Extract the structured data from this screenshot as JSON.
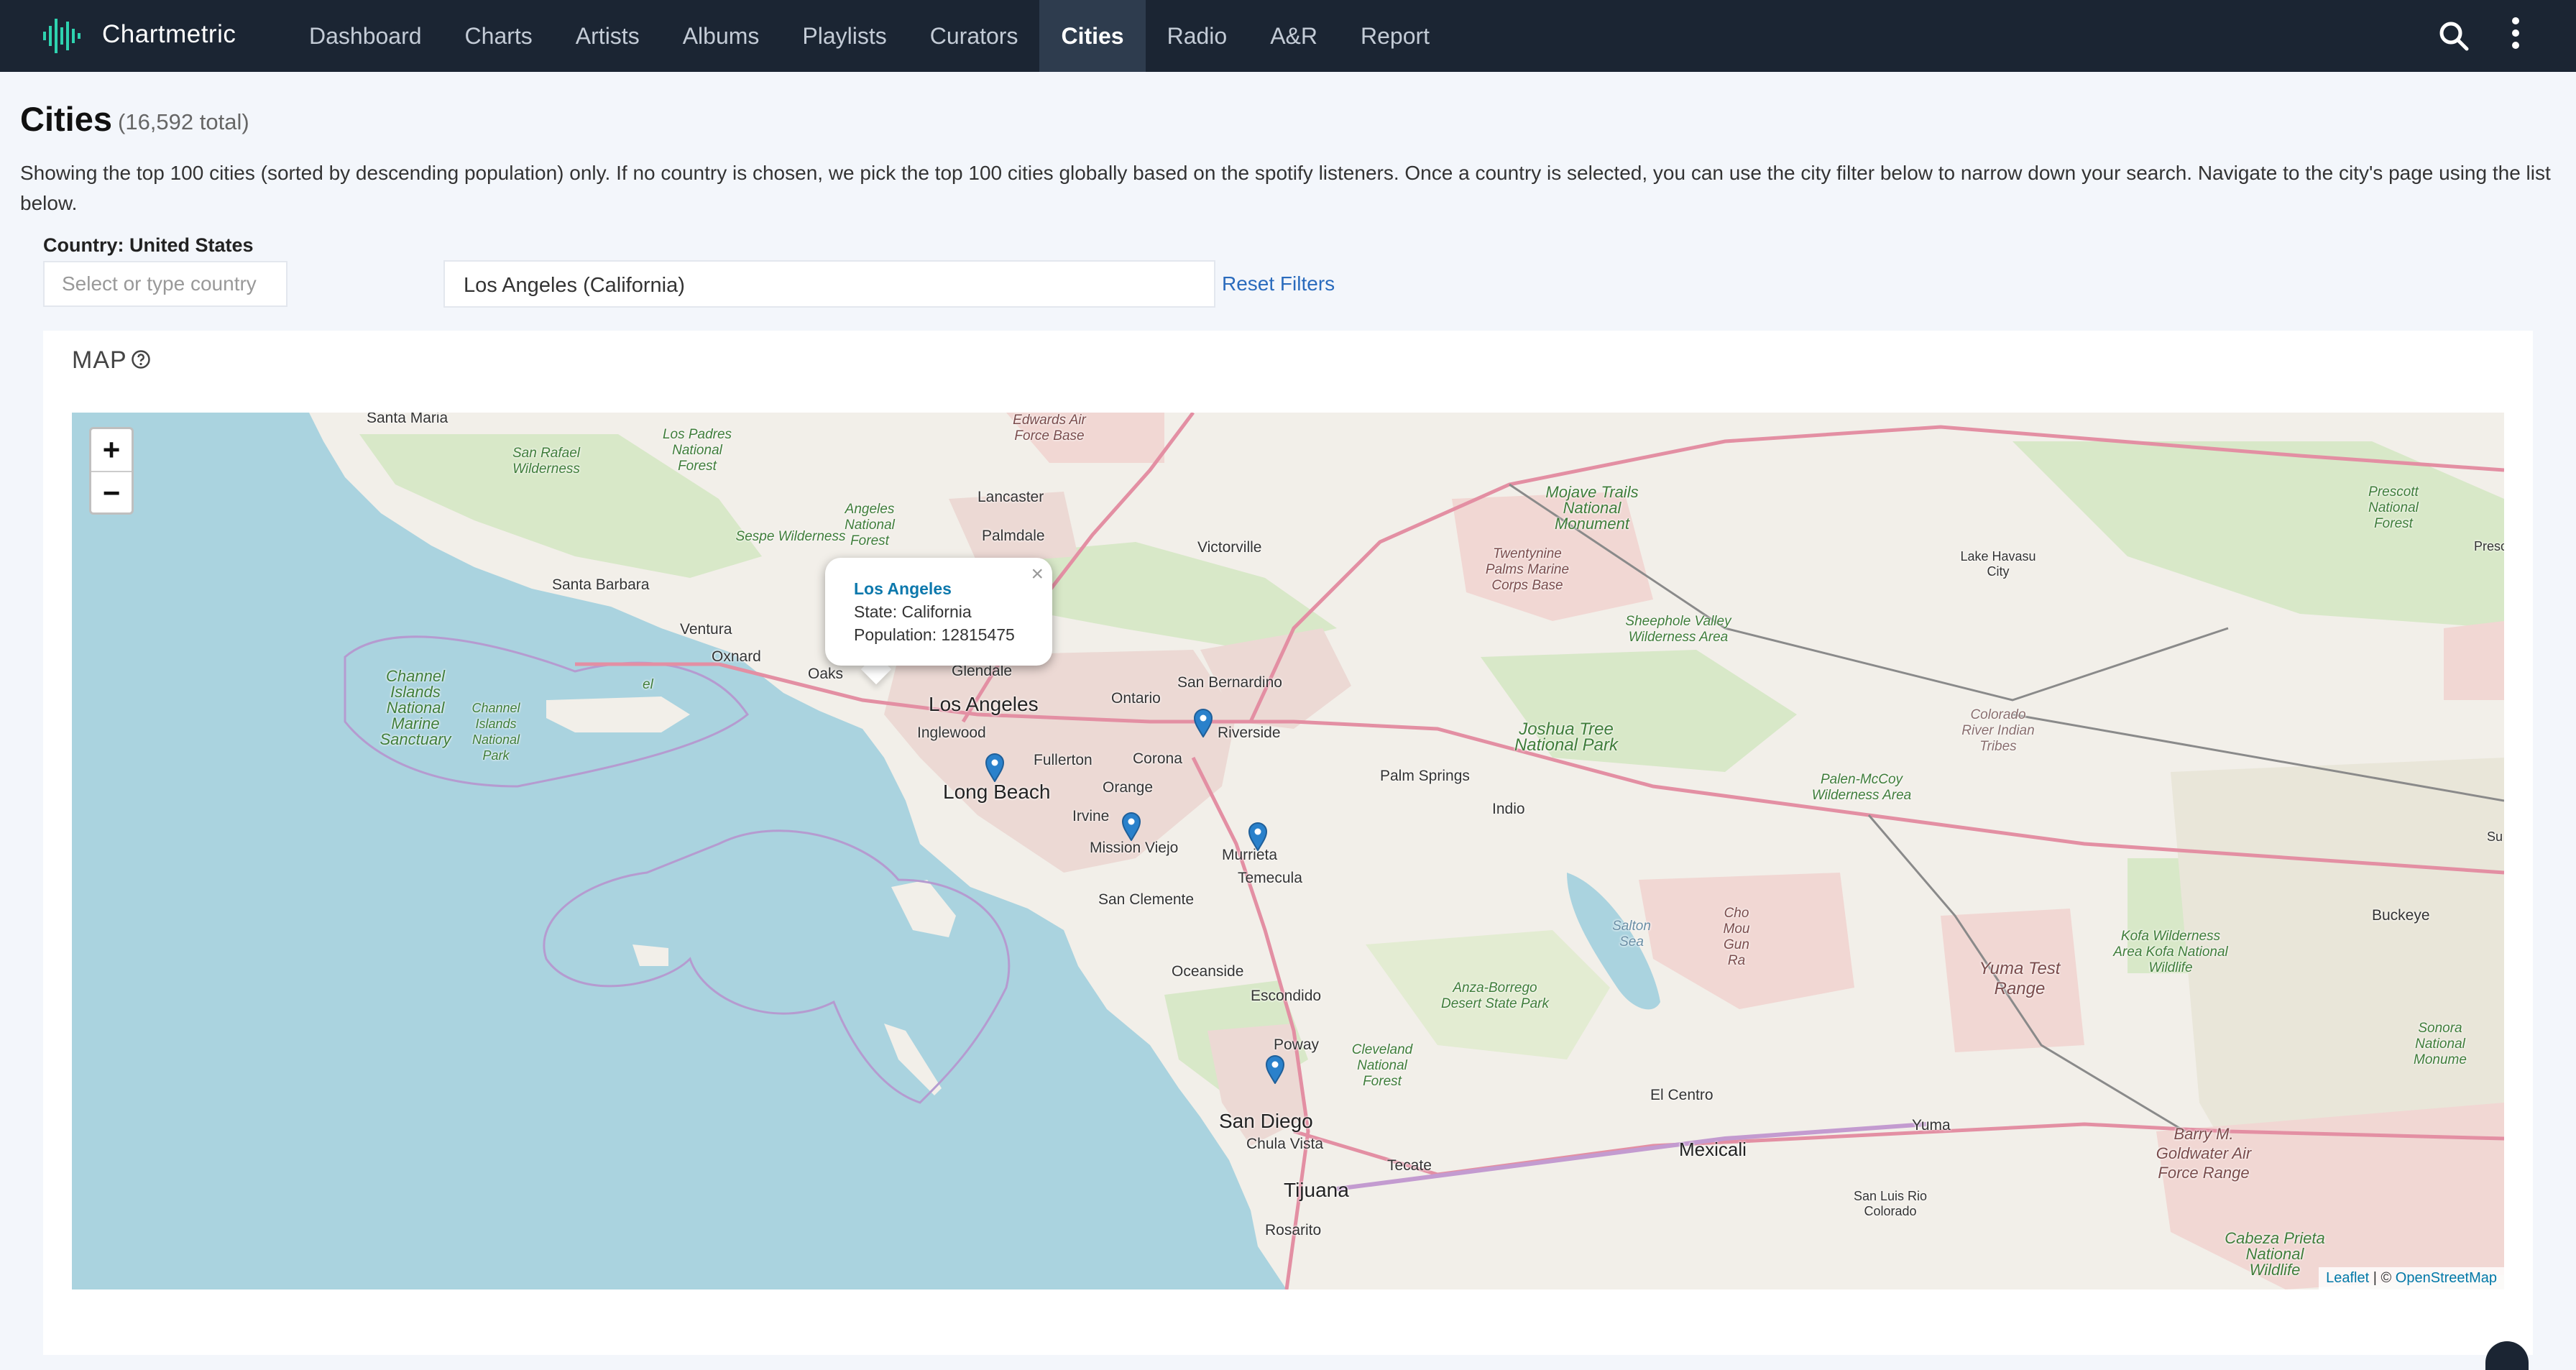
{
  "app": {
    "brand": "Chartmetric",
    "nav": [
      "Dashboard",
      "Charts",
      "Artists",
      "Albums",
      "Playlists",
      "Curators",
      "Cities",
      "Radio",
      "A&R",
      "Report"
    ],
    "active_nav": "Cities"
  },
  "page": {
    "title": "Cities",
    "count": "(16,592 total)",
    "intro": "Showing the top 100 cities (sorted by descending population) only. If no country is chosen, we pick the top 100 cities globally based on the spotify listeners. Once a country is selected, you can use the city filter below to narrow down your search. Navigate to the city's page using the list below."
  },
  "filters": {
    "country_label": "Country: United States",
    "country_placeholder": "Select or type country",
    "city_value": "Los Angeles (California)",
    "reset_label": "Reset Filters"
  },
  "map": {
    "heading": "MAP",
    "zoom_in": "+",
    "zoom_out": "−",
    "popup": {
      "city": "Los Angeles",
      "state": "State: California",
      "population": "Population: 12815475",
      "close": "×"
    },
    "attribution": {
      "leaflet": "Leaflet",
      "sep": " | © ",
      "osm": "OpenStreetMap"
    },
    "labels": {
      "santa_maria": "Santa Maria",
      "san_rafael": "San Rafael Wilderness",
      "los_padres": "Los Padres National Forest",
      "edwards": "Edwards Air Force Base",
      "lancaster": "Lancaster",
      "palmdale": "Palmdale",
      "angeles_nf": "Angeles National Forest",
      "sespe": "Sespe Wilderness",
      "victorville": "Victorville",
      "mojave": "Mojave Trails National Monument",
      "twentynine": "Twentynine Palms Marine Corps Base",
      "lake_havasu": "Lake Havasu City",
      "prescott": "Prescott National Forest",
      "presc": "Presc",
      "santa_barbara": "Santa Barbara",
      "ventura": "Ventura",
      "oxnard": "Oxnard",
      "oaks": "Oaks",
      "glendale": "Glendale",
      "san_bernardino": "San Bernardino",
      "sheephole": "Sheephole Valley Wilderness Area",
      "channel_nms": "Channel Islands National Marine Sanctuary",
      "channel_np": "Channel Islands National Park",
      "el": "el",
      "los_angeles": "Los Angeles",
      "ontario": "Ontario",
      "riverside": "Riverside",
      "inglewood": "Inglewood",
      "fullerton": "Fullerton",
      "corona": "Corona",
      "joshua_tree": "Joshua Tree National Park",
      "colorado_river": "Colorado River Indian Tribes",
      "palm_springs": "Palm Springs",
      "long_beach": "Long Beach",
      "indio": "Indio",
      "palen": "Palen-McCoy Wilderness Area",
      "irvine": "Irvine",
      "orange": "Orange",
      "mission_viejo": "Mission Viejo",
      "murrieta": "Murrieta",
      "temecula": "Temecula",
      "san_clemente": "San Clemente",
      "salton_sea": "Salton Sea",
      "chocolate": "Cho Mou Gun Ra",
      "buckeye": "Buckeye",
      "kofa": "Kofa Wilderness Area Kofa National Wildlife",
      "yuma_test": "Yuma Test Range",
      "oceanside": "Oceanside",
      "escondido": "Escondido",
      "anza": "Anza-Borrego Desert State Park",
      "poway": "Poway",
      "cleveland": "Cleveland National Forest",
      "sonoran": "Sonora National Monume",
      "el_centro": "El Centro",
      "san_diego": "San Diego",
      "yuma": "Yuma",
      "chula_vista": "Chula Vista",
      "mexicali": "Mexicali",
      "goldwater": "Barry M. Goldwater Air Force Range",
      "tecate": "Tecate",
      "tijuana": "Tijuana",
      "san_luis": "San Luis Rio Colorado",
      "rosarito": "Rosarito",
      "cabeza": "Cabeza Prieta National Wildlife",
      "su": "Su"
    }
  }
}
